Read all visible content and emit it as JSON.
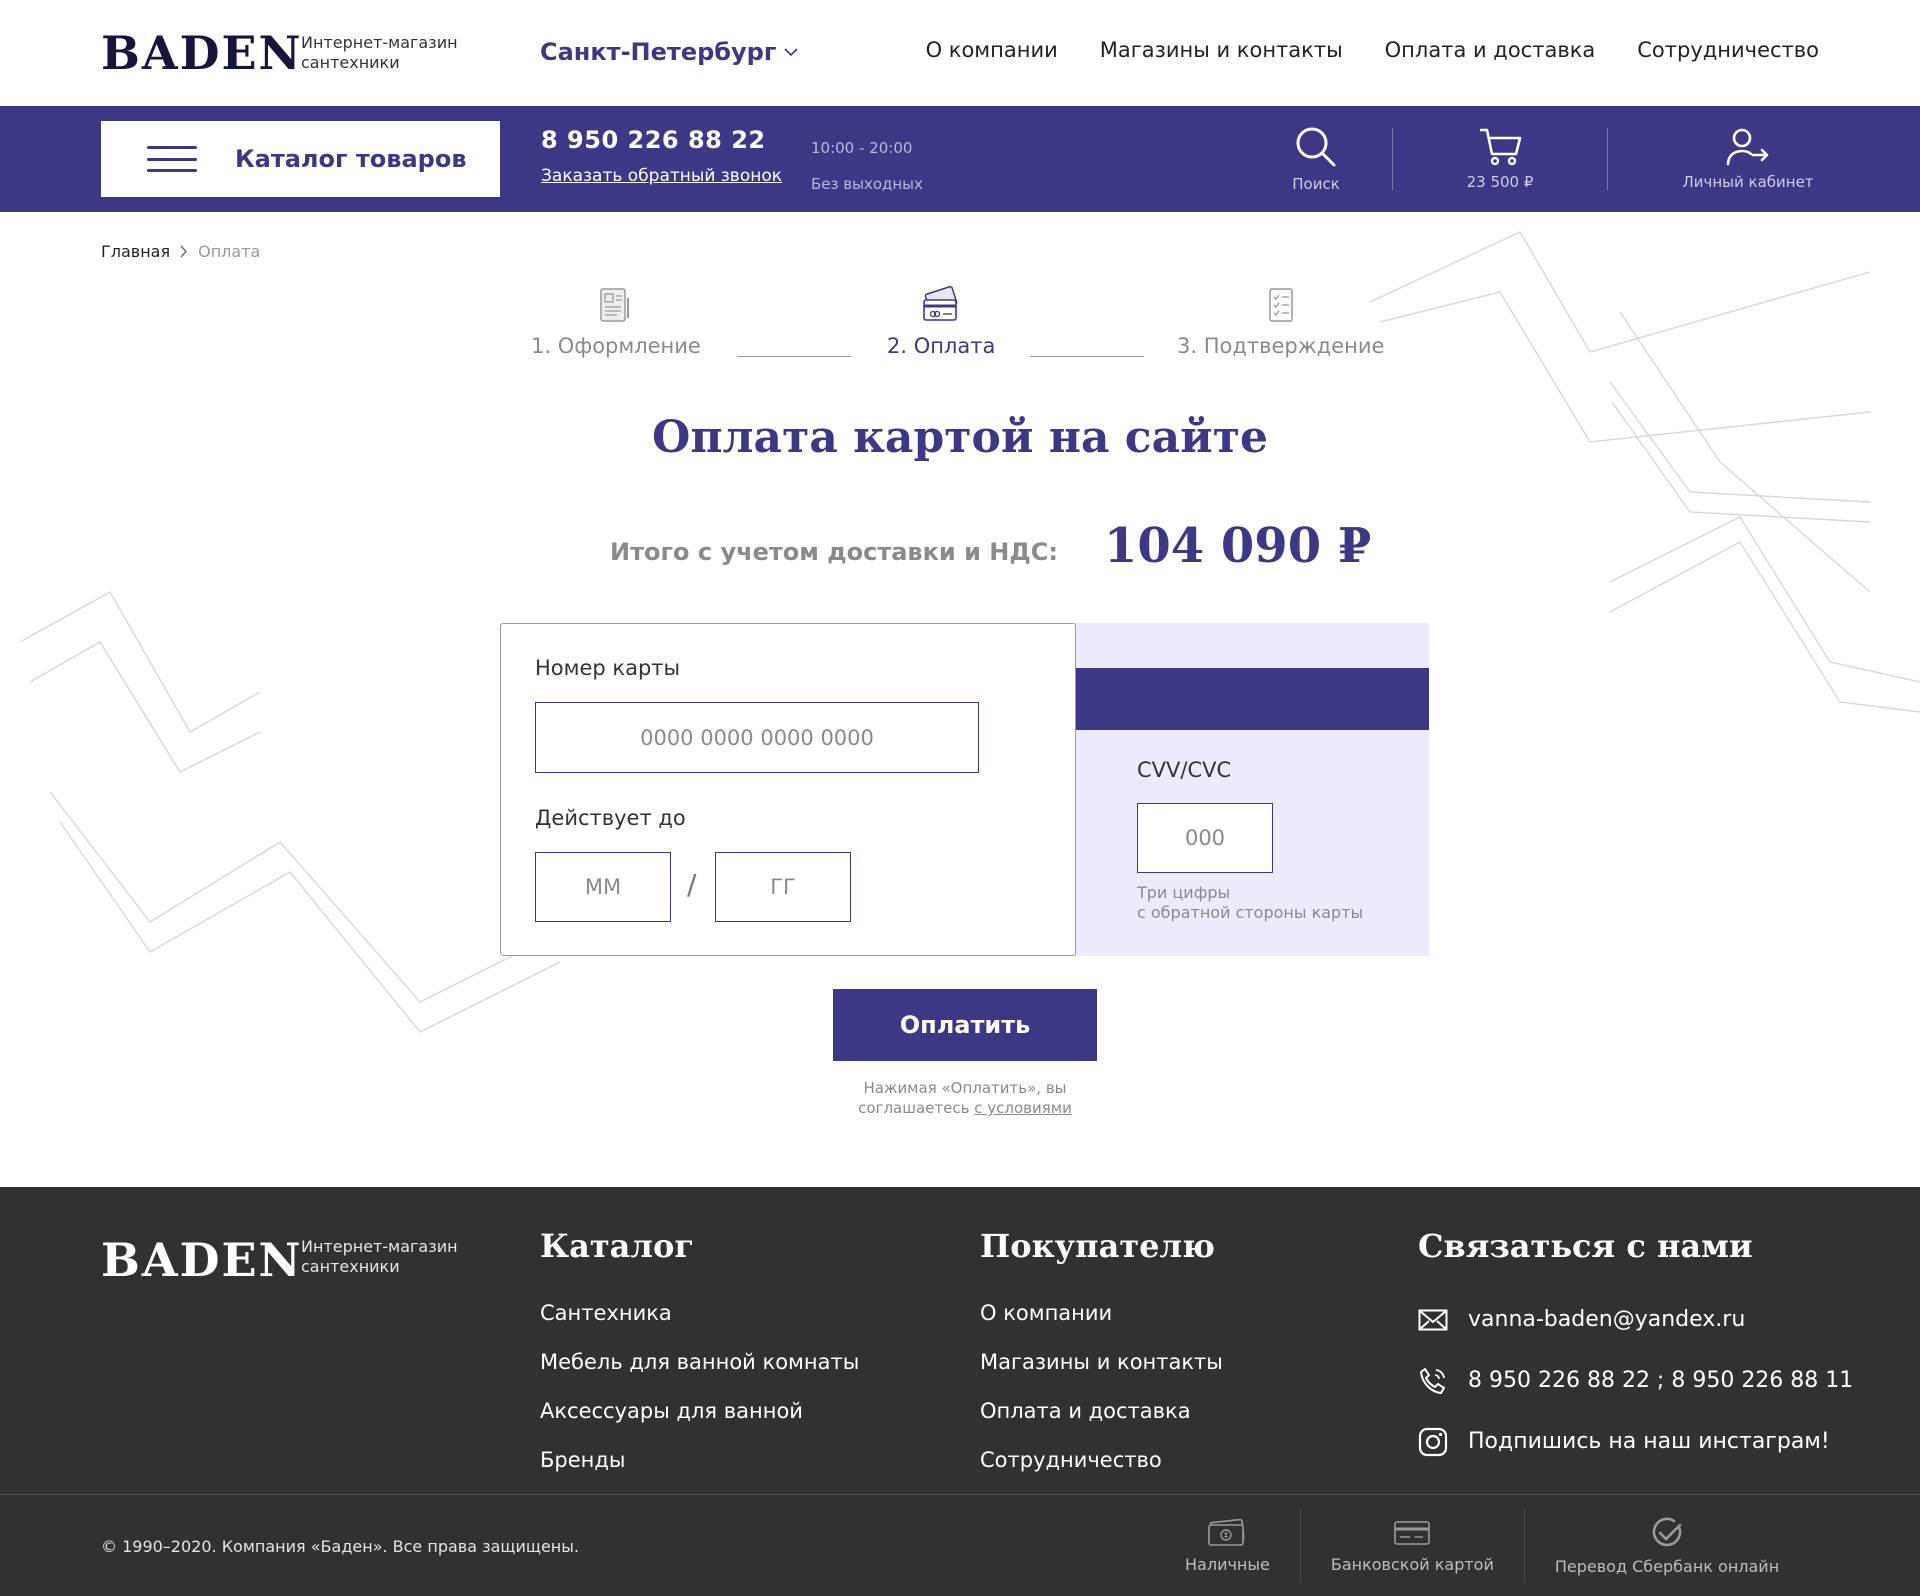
{
  "header": {
    "logo": "BADEN",
    "logo_sub_1": "Интернет-магазин",
    "logo_sub_2": "сантехники",
    "city": "Санкт-Петербург",
    "nav": [
      "О компании",
      "Магазины и контакты",
      "Оплата и доставка",
      "Сотрудничество"
    ]
  },
  "bar": {
    "catalog_label": "Каталог товаров",
    "phone": "8 950 226 88 22",
    "callback": "Заказать обратный звонок",
    "hours": "10:00 - 20:00",
    "days": "Без выходных",
    "search_label": "Поиск",
    "cart_label": "23 500 ₽",
    "account_label": "Личный кабинет"
  },
  "breadcrumb": {
    "home": "Главная",
    "current": "Оплата"
  },
  "steps": [
    {
      "label": "1. Оформление",
      "active": false
    },
    {
      "label": "2. Оплата",
      "active": true
    },
    {
      "label": "3. Подтверждение",
      "active": false
    }
  ],
  "page": {
    "title": "Оплата картой на сайте",
    "total_label": "Итого с учетом доставки и НДС:",
    "total_value": "104 090 ₽"
  },
  "card_form": {
    "number_label": "Номер карты",
    "number_placeholder": "0000 0000 0000 0000",
    "expiry_label": "Действует до",
    "month_placeholder": "ММ",
    "slash": "/",
    "year_placeholder": "ГГ",
    "cvv_label": "CVV/CVC",
    "cvv_placeholder": "000",
    "cvv_hint_1": "Три цифры",
    "cvv_hint_2": "с обратной стороны карты"
  },
  "pay": {
    "button": "Оплатить",
    "agree_text_1": "Нажимая «Оплатить», вы",
    "agree_text_2": "соглашаетесь",
    "agree_link": "с условиями"
  },
  "footer": {
    "logo": "BADEN",
    "logo_sub_1": "Интернет-магазин",
    "logo_sub_2": "сантехники",
    "catalog": {
      "heading": "Каталог",
      "links": [
        "Сантехника",
        "Мебель для ванной комнаты",
        "Аксессуары для ванной",
        "Бренды"
      ]
    },
    "buyer": {
      "heading": "Покупателю",
      "links": [
        "О компании",
        "Магазины и контакты",
        "Оплата и доставка",
        "Сотрудничество"
      ]
    },
    "contact": {
      "heading": "Связаться с нами",
      "email": "vanna-baden@yandex.ru",
      "phones": "8 950 226 88 22 ; 8 950 226 88 11",
      "instagram": "Подпишись на наш инстаграм!"
    },
    "copyright": "© 1990–2020. Компания «Баден». Все права защищены.",
    "payment_methods": [
      "Наличные",
      "Банковской картой",
      "Перевод Сбербанк онлайн"
    ]
  },
  "colors": {
    "brand": "#3c3886",
    "footer_bg": "#313131",
    "card_back": "#ecebfb"
  }
}
